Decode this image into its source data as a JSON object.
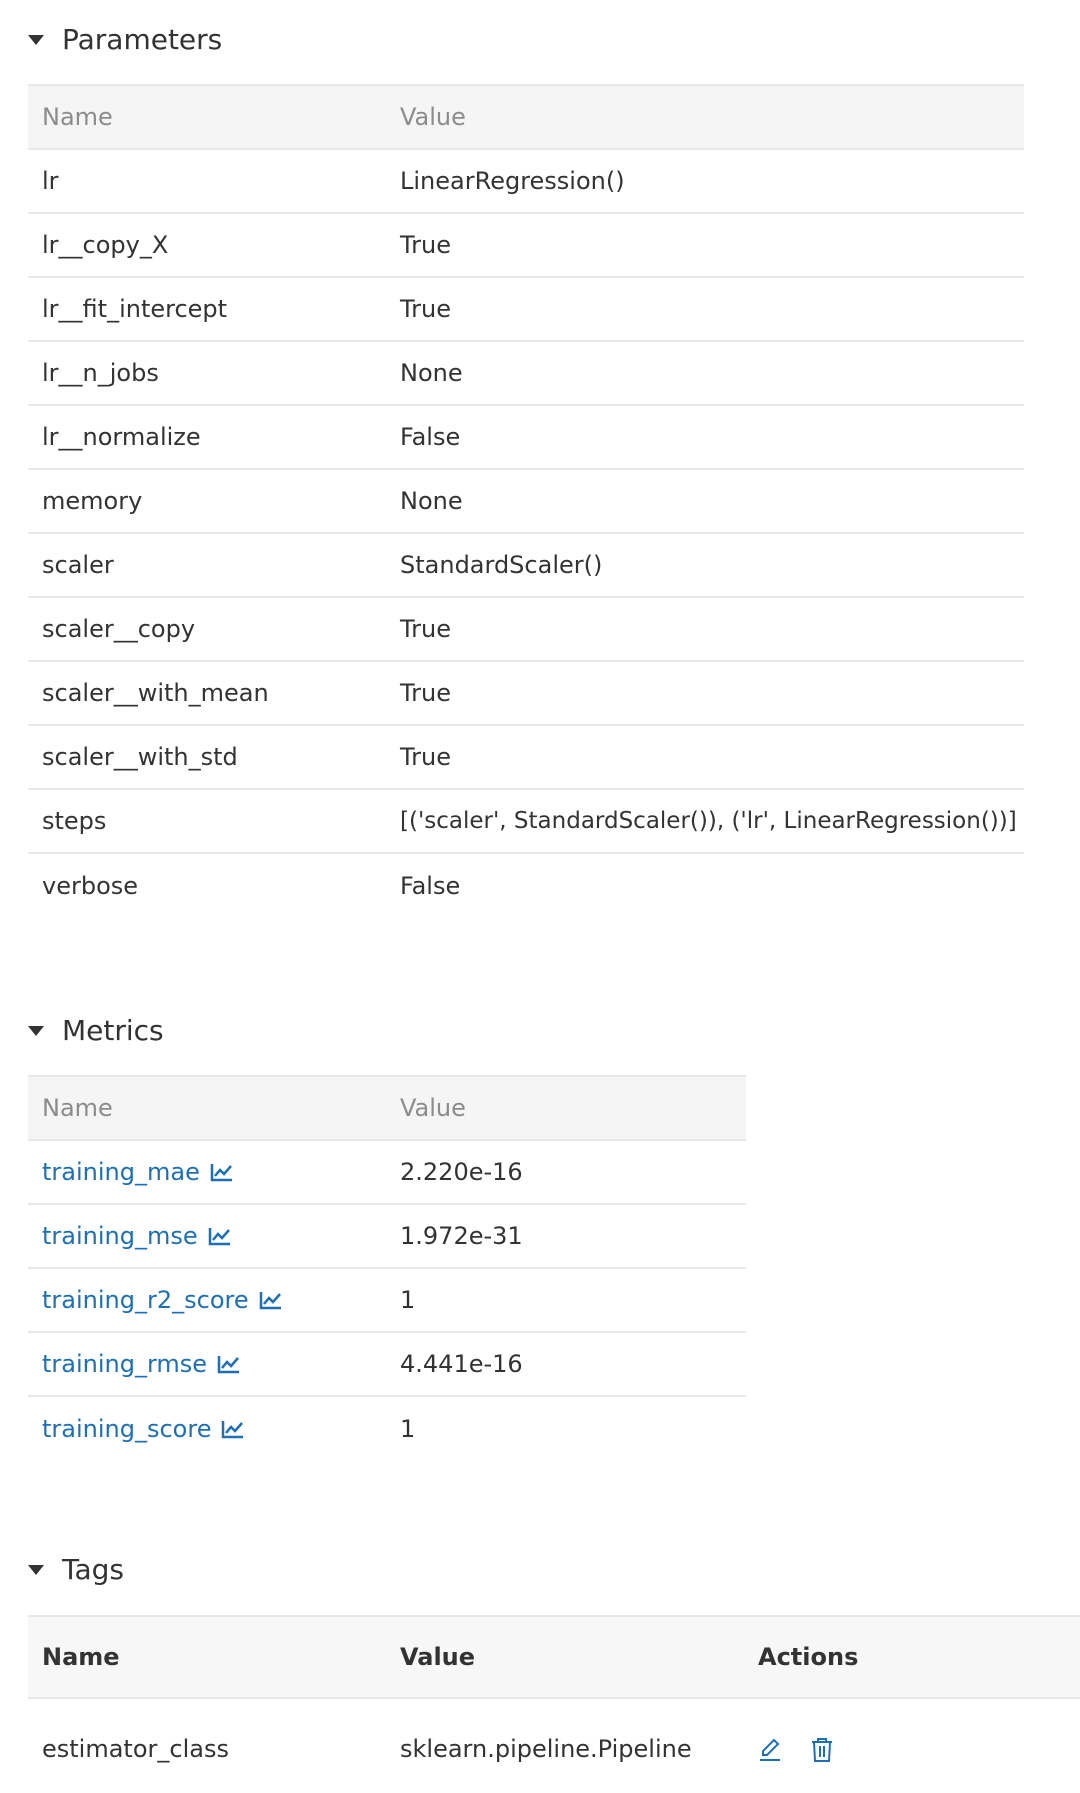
{
  "colors": {
    "link": "#1f6fb5",
    "text": "#333333",
    "muted": "#8c8c8c",
    "header_bg": "#f5f5f5",
    "border": "#e8e8e8"
  },
  "parameters": {
    "title": "Parameters",
    "headers": {
      "name": "Name",
      "value": "Value"
    },
    "rows": [
      {
        "name": "lr",
        "value": "LinearRegression()"
      },
      {
        "name": "lr__copy_X",
        "value": "True"
      },
      {
        "name": "lr__fit_intercept",
        "value": "True"
      },
      {
        "name": "lr__n_jobs",
        "value": "None"
      },
      {
        "name": "lr__normalize",
        "value": "False"
      },
      {
        "name": "memory",
        "value": "None"
      },
      {
        "name": "scaler",
        "value": "StandardScaler()"
      },
      {
        "name": "scaler__copy",
        "value": "True"
      },
      {
        "name": "scaler__with_mean",
        "value": "True"
      },
      {
        "name": "scaler__with_std",
        "value": "True"
      },
      {
        "name": "steps",
        "value": "[('scaler', StandardScaler()), ('lr', LinearRegression())]"
      },
      {
        "name": "verbose",
        "value": "False"
      }
    ]
  },
  "metrics": {
    "title": "Metrics",
    "headers": {
      "name": "Name",
      "value": "Value"
    },
    "rows": [
      {
        "name": "training_mae",
        "value": "2.220e-16",
        "icon": "line-chart-icon"
      },
      {
        "name": "training_mse",
        "value": "1.972e-31",
        "icon": "line-chart-icon"
      },
      {
        "name": "training_r2_score",
        "value": "1",
        "icon": "line-chart-icon"
      },
      {
        "name": "training_rmse",
        "value": "4.441e-16",
        "icon": "line-chart-icon"
      },
      {
        "name": "training_score",
        "value": "1",
        "icon": "line-chart-icon"
      }
    ]
  },
  "tags": {
    "title": "Tags",
    "headers": {
      "name": "Name",
      "value": "Value",
      "actions": "Actions"
    },
    "rows": [
      {
        "name": "estimator_class",
        "value": "sklearn.pipeline.Pipeline",
        "actions": [
          "edit-icon",
          "trash-icon"
        ]
      }
    ]
  }
}
